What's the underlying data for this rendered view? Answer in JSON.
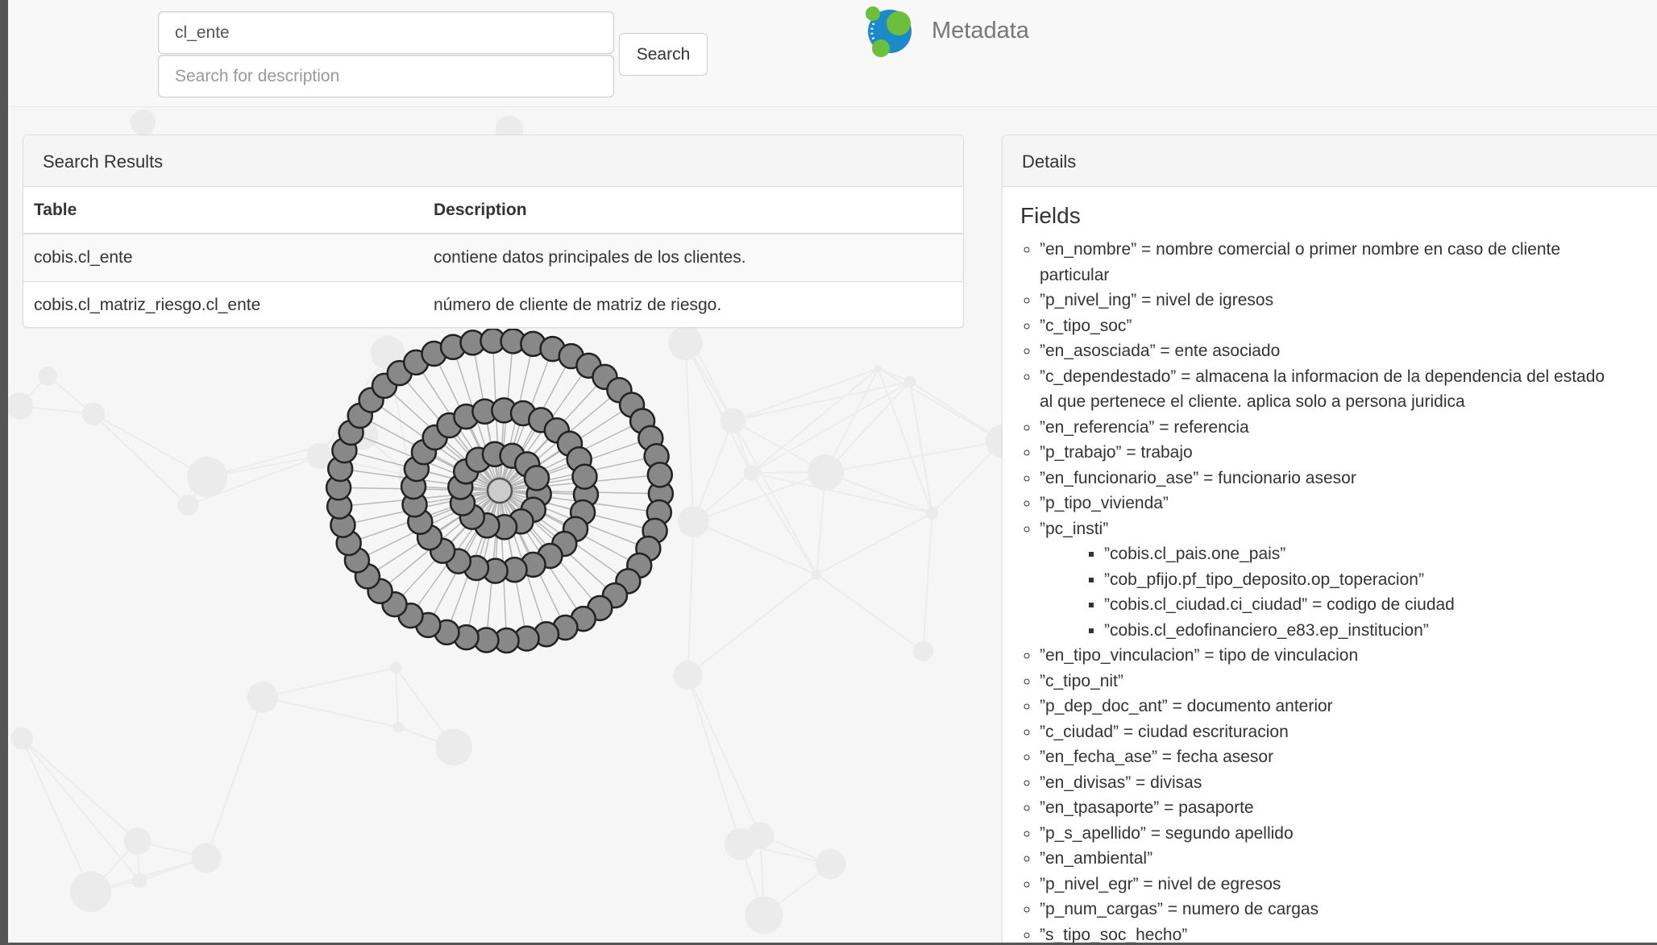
{
  "header": {
    "search_value": "cl_ente",
    "description_placeholder": "Search for description",
    "search_button": "Search",
    "brand": "Metadata",
    "logo_icon": "neo4j-logo-icon"
  },
  "results": {
    "title": "Search Results",
    "columns": [
      "Table",
      "Description"
    ],
    "rows": [
      {
        "table": "cobis.cl_ente",
        "description": "contiene datos principales de los clientes."
      },
      {
        "table": "cobis.cl_matriz_riesgo.cl_ente",
        "description": "número de cliente de matriz de riesgo."
      }
    ]
  },
  "details": {
    "title": "Details",
    "fields_heading": "Fields",
    "fields": [
      "”en_nombre” = nombre comercial o primer nombre en caso de cliente particular",
      "”p_nivel_ing” = nivel de igresos",
      "”c_tipo_soc”",
      "”en_asosciada” = ente asociado",
      "”c_dependestado” = almacena la informacion de la dependencia del estado al que pertenece el cliente. aplica solo a persona juridica",
      "”en_referencia” = referencia",
      "”p_trabajo” = trabajo",
      "”en_funcionario_ase” = funcionario asesor",
      "”p_tipo_vivienda”",
      "”pc_insti”",
      "”en_tipo_vinculacion” = tipo de vinculacion",
      "”c_tipo_nit”",
      "”p_dep_doc_ant” = documento anterior",
      "”c_ciudad” = ciudad escrituracion",
      "”en_fecha_ase” = fecha asesor",
      "”en_divisas” = divisas",
      "”en_tpasaporte” = pasaporte",
      "”p_s_apellido” = segundo apellido",
      "”en_ambiental”",
      "”p_nivel_egr” = nivel de egresos",
      "”p_num_cargas” = numero de cargas",
      "”s_tipo_soc_hecho”"
    ],
    "pc_insti_children": [
      "”cobis.cl_pais.one_pais”",
      "”cob_pfijo.pf_tipo_deposito.op_toperacion”",
      "”cobis.cl_ciudad.ci_ciudad” = codigo de ciudad",
      "”cobis.cl_edofinanciero_e83.ep_institucion”"
    ]
  },
  "graph": {
    "center_node_color": "#cccccc",
    "node_color": "#888888",
    "edge_color": "#b8b8b8"
  }
}
